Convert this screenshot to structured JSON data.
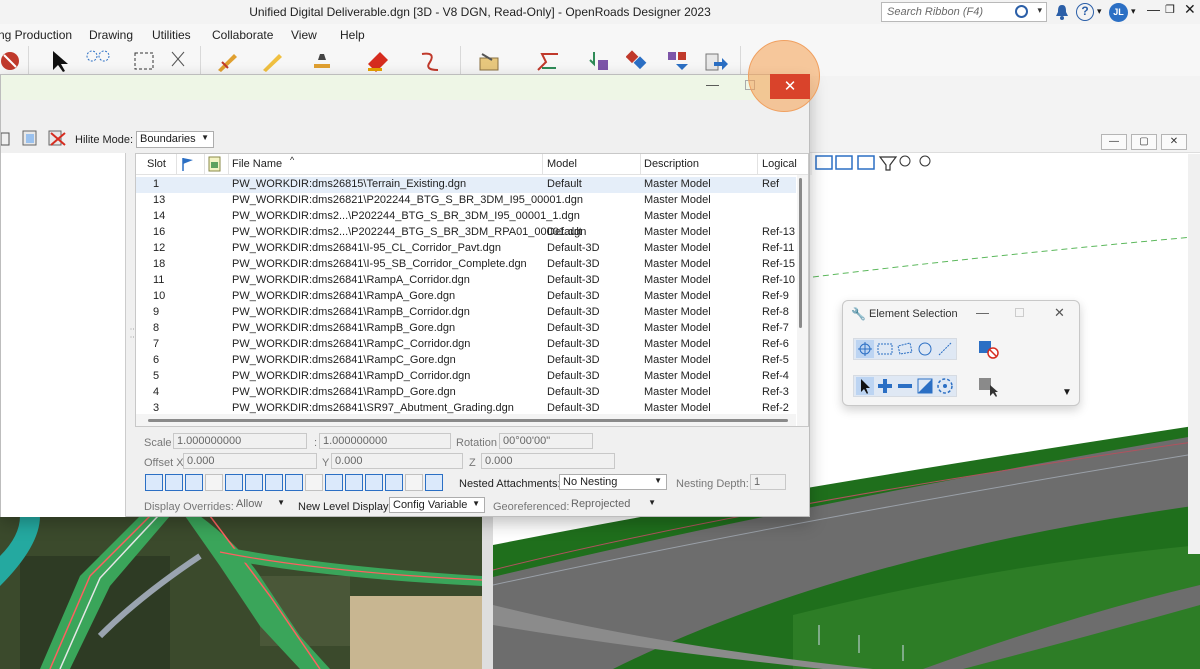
{
  "app": {
    "title": "Unified Digital Deliverable.dgn [3D - V8 DGN, Read-Only] - OpenRoads Designer 2023",
    "search_placeholder": "Search Ribbon (F4)",
    "help_glyph": "?",
    "user_initials": "JL",
    "window_controls": {
      "minimize": "—",
      "restore": "❐",
      "close": "✕"
    }
  },
  "menu": [
    "ng Production",
    "Drawing",
    "Utilities",
    "Collaborate",
    "View",
    "Help"
  ],
  "ribbon_icons": [
    "cancel-icon",
    "select-arrow-icon",
    "fence-icons",
    "selection-rect-icon",
    "scissors-icon",
    "pencil-placement-icon",
    "pencil-icon",
    "tree-cell-icon",
    "red-eraser-icon",
    "curve-arrow-icon",
    "folder-models-icon",
    "horizontal-geometry-icon",
    "profile-icon",
    "corridor-icon",
    "element-info-icon",
    "civil-cells-icon",
    "export-icon"
  ],
  "ref_dialog": {
    "minimize": "—",
    "close": "✕",
    "hilite_label": "Hilite Mode:",
    "hilite_value": "Boundaries",
    "columns": {
      "slot": "Slot",
      "file_name": "File Name",
      "model": "Model",
      "description": "Description",
      "logical": "Logical"
    },
    "rows": [
      {
        "slot": "1",
        "file": "PW_WORKDIR:dms26815\\Terrain_Existing.dgn",
        "model": "Default",
        "desc": "Master Model",
        "logical": "Ref"
      },
      {
        "slot": "13",
        "file": "PW_WORKDIR:dms26821\\P202244_BTG_S_BR_3DM_I95_00001.dgn",
        "model": "",
        "desc": "Master Model",
        "logical": ""
      },
      {
        "slot": "14",
        "file": "PW_WORKDIR:dms2...\\P202244_BTG_S_BR_3DM_I95_00001_1.dgn",
        "model": "",
        "desc": "Master Model",
        "logical": ""
      },
      {
        "slot": "16",
        "file": "PW_WORKDIR:dms2...\\P202244_BTG_S_BR_3DM_RPA01_00001.dgn",
        "model": "Default",
        "desc": "Master Model",
        "logical": "Ref-13"
      },
      {
        "slot": "12",
        "file": "PW_WORKDIR:dms26841\\I-95_CL_Corridor_Pavt.dgn",
        "model": "Default-3D",
        "desc": "Master Model",
        "logical": "Ref-11"
      },
      {
        "slot": "18",
        "file": "PW_WORKDIR:dms26841\\I-95_SB_Corridor_Complete.dgn",
        "model": "Default-3D",
        "desc": "Master Model",
        "logical": "Ref-15"
      },
      {
        "slot": "11",
        "file": "PW_WORKDIR:dms26841\\RampA_Corridor.dgn",
        "model": "Default-3D",
        "desc": "Master Model",
        "logical": "Ref-10"
      },
      {
        "slot": "10",
        "file": "PW_WORKDIR:dms26841\\RampA_Gore.dgn",
        "model": "Default-3D",
        "desc": "Master Model",
        "logical": "Ref-9"
      },
      {
        "slot": "9",
        "file": "PW_WORKDIR:dms26841\\RampB_Corridor.dgn",
        "model": "Default-3D",
        "desc": "Master Model",
        "logical": "Ref-8"
      },
      {
        "slot": "8",
        "file": "PW_WORKDIR:dms26841\\RampB_Gore.dgn",
        "model": "Default-3D",
        "desc": "Master Model",
        "logical": "Ref-7"
      },
      {
        "slot": "7",
        "file": "PW_WORKDIR:dms26841\\RampC_Corridor.dgn",
        "model": "Default-3D",
        "desc": "Master Model",
        "logical": "Ref-6"
      },
      {
        "slot": "6",
        "file": "PW_WORKDIR:dms26841\\RampC_Gore.dgn",
        "model": "Default-3D",
        "desc": "Master Model",
        "logical": "Ref-5"
      },
      {
        "slot": "5",
        "file": "PW_WORKDIR:dms26841\\RampD_Corridor.dgn",
        "model": "Default-3D",
        "desc": "Master Model",
        "logical": "Ref-4"
      },
      {
        "slot": "4",
        "file": "PW_WORKDIR:dms26841\\RampD_Gore.dgn",
        "model": "Default-3D",
        "desc": "Master Model",
        "logical": "Ref-3"
      },
      {
        "slot": "3",
        "file": "PW_WORKDIR:dms26841\\SR97_Abutment_Grading.dgn",
        "model": "Default-3D",
        "desc": "Master Model",
        "logical": "Ref-2"
      }
    ],
    "props": {
      "scale_label": "Scale",
      "scale_a": "1.000000000",
      "scale_sep": ":",
      "scale_b": "1.000000000",
      "rotation_label": "Rotation",
      "rotation": "00°00'00\"",
      "offset_x_label": "Offset X",
      "offset_x": "0.000",
      "y_label": "Y",
      "y": "0.000",
      "z_label": "Z",
      "z": "0.000",
      "nested_label": "Nested Attachments:",
      "nested_value": "No Nesting",
      "nesting_depth_label": "Nesting Depth:",
      "nesting_depth": "1",
      "display_overrides_label": "Display Overrides:",
      "display_overrides": "Allow",
      "new_level_label": "New Level Display:",
      "new_level": "Config Variable",
      "georef_label": "Georeferenced:",
      "georef": "Reprojected"
    }
  },
  "element_selection": {
    "title": "Element Selection",
    "minimize": "—",
    "close": "✕"
  },
  "colors": {
    "close_red": "#d9432b",
    "highlight_orange": "#f0a060",
    "selection_blue": "#2b6fc4"
  }
}
